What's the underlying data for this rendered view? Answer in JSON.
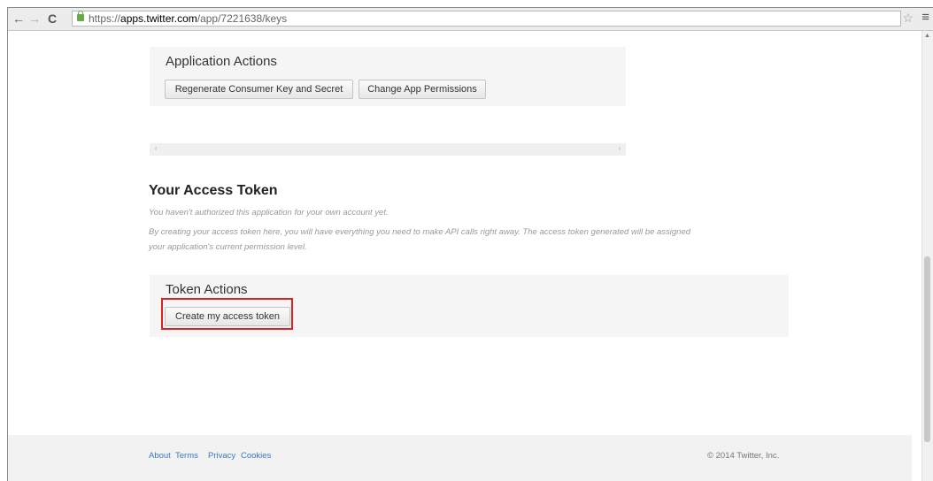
{
  "browser": {
    "back_glyph": "←",
    "forward_glyph": "→",
    "reload_glyph": "C",
    "url_scheme": "https://",
    "url_host": "apps.twitter.com",
    "url_path": "/app/7221638/keys",
    "star_glyph": "☆",
    "menu_glyph": "≡"
  },
  "app_actions": {
    "title": "Application Actions",
    "regenerate_label": "Regenerate Consumer Key and Secret",
    "permissions_label": "Change App Permissions"
  },
  "hscroll": {
    "left_glyph": "‹",
    "right_glyph": "›"
  },
  "access_token": {
    "title": "Your Access Token",
    "not_authorized": "You haven't authorized this application for your own account yet.",
    "description_line1": "By creating your access token here, you will have everything you need to make API calls right away. The access token generated will be assigned",
    "description_line2": "your application's current permission level."
  },
  "token_actions": {
    "title": "Token Actions",
    "create_label": "Create my access token"
  },
  "footer": {
    "about": "About",
    "terms": "Terms",
    "privacy": "Privacy",
    "cookies": "Cookies",
    "copyright": "© 2014 Twitter, Inc."
  },
  "colors": {
    "highlight": "#e02020",
    "link": "#3b78c4"
  }
}
